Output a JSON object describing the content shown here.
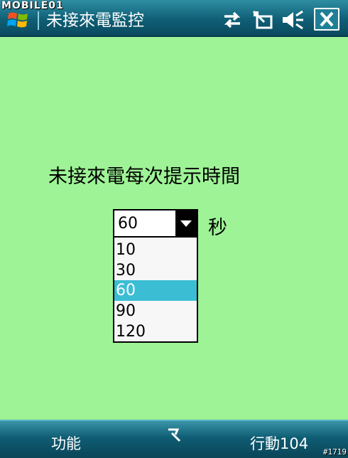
{
  "watermark": "MOBILE01",
  "titlebar": {
    "title": "未接來電監控",
    "icons": [
      "windows-start-icon",
      "connectivity-icon",
      "phone-off-icon",
      "volume-muted-icon",
      "close-icon"
    ]
  },
  "content": {
    "prompt": "未接來電每次提示時間",
    "select": {
      "value": "60",
      "options": [
        "10",
        "30",
        "60",
        "90",
        "120"
      ],
      "selected_index": 2
    },
    "unit": "秒"
  },
  "softkeys": {
    "left": "功能",
    "right": "行動104",
    "middle_icon": "input-method-icon"
  },
  "corner_id": "#1719",
  "colors": {
    "background": "#9ef396",
    "titlebar": "#0f5f76",
    "highlight": "#3bbdd4"
  }
}
